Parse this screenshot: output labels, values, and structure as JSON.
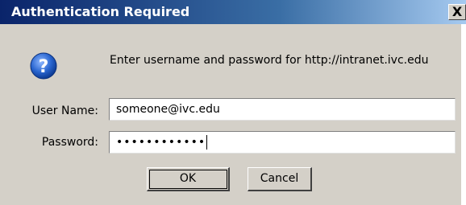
{
  "window": {
    "title": "Authentication Required",
    "close_label": "X"
  },
  "dialog": {
    "icon": "question-icon",
    "message": "Enter username and password for http://intranet.ivc.edu",
    "username_label": "User Name:",
    "username_value": "someone@ivc.edu",
    "password_label": "Password:",
    "password_value": "••••••••••••",
    "ok_label": "OK",
    "cancel_label": "Cancel"
  },
  "colors": {
    "titlebar_start": "#0a246a",
    "titlebar_end": "#a6caf0",
    "dialog_bg": "#d4d0c8",
    "icon_blue": "#1f5fc8"
  }
}
